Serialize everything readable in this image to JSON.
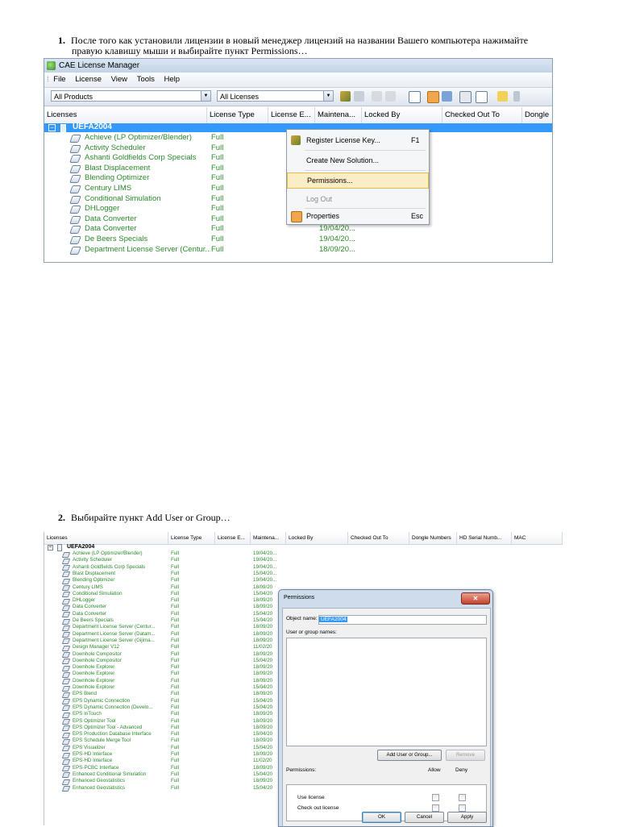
{
  "step1": {
    "number": "1.",
    "text_line1": "После того как установили лицензии в новый менеджер лицензий на названии Вашего компьютера нажимайте",
    "text_line2": "правую клавишу мыши и выбирайте пункт Permissions…"
  },
  "step2": {
    "number": "2.",
    "text": "Выбирайте пункт Add User or Group…"
  },
  "window1": {
    "title": "CAE License Manager",
    "app_icon": "cae-app-icon",
    "menu": [
      "File",
      "License",
      "View",
      "Tools",
      "Help"
    ],
    "products_filter": "All Products",
    "licenses_filter": "All Licenses",
    "columns": [
      "Licenses",
      "License Type",
      "License E...",
      "Maintena...",
      "Locked By",
      "Checked Out To",
      "Dongle"
    ],
    "root_node": "UEFA2004",
    "rows": [
      {
        "name": "Achieve (LP Optimizer/Blender)",
        "type": "Full",
        "date": ""
      },
      {
        "name": "Activity Scheduler",
        "type": "Full",
        "date": ""
      },
      {
        "name": "Ashanti Goldfields Corp Specials",
        "type": "Full",
        "date": ""
      },
      {
        "name": "Blast Displacement",
        "type": "Full",
        "date": ""
      },
      {
        "name": "Blending Optimizer",
        "type": "Full",
        "date": ""
      },
      {
        "name": "Century LIMS",
        "type": "Full",
        "date": ""
      },
      {
        "name": "Conditional Simulation",
        "type": "Full",
        "date": ""
      },
      {
        "name": "DHLogger",
        "type": "Full",
        "date": ""
      },
      {
        "name": "Data Converter",
        "type": "Full",
        "date": ""
      },
      {
        "name": "Data Converter",
        "type": "Full",
        "date": "19/04/20..."
      },
      {
        "name": "De Beers Specials",
        "type": "Full",
        "date": "19/04/20..."
      },
      {
        "name": "Department License Server (Centur...",
        "type": "Full",
        "date": "18/09/20..."
      }
    ],
    "context_menu": [
      {
        "label": "Register License Key...",
        "shortcut": "F1",
        "icon": "key-icon",
        "state": "normal"
      },
      {
        "label": "Create New Solution...",
        "shortcut": "",
        "icon": "",
        "state": "normal"
      },
      {
        "label": "Permissions...",
        "shortcut": "",
        "icon": "",
        "state": "highlighted"
      },
      {
        "label": "Log Out",
        "shortcut": "",
        "icon": "",
        "state": "disabled"
      },
      {
        "label": "Properties",
        "shortcut": "Esc",
        "icon": "properties-icon",
        "state": "normal"
      }
    ]
  },
  "window2": {
    "columns": [
      "Licenses",
      "License Type",
      "License E...",
      "Maintena...",
      "Locked By",
      "Checked Out To",
      "Dongle Numbers",
      "HD Serial Numb...",
      "MAC"
    ],
    "root_node": "UEFA2004",
    "rows": [
      {
        "name": "Achieve (LP Optimizer/Blender)",
        "type": "Full",
        "date": "19/04/20..."
      },
      {
        "name": "Activity Scheduler",
        "type": "Full",
        "date": "19/04/20..."
      },
      {
        "name": "Ashanti Goldfields Corp Specials",
        "type": "Full",
        "date": "19/04/20..."
      },
      {
        "name": "Blast Displacement",
        "type": "Full",
        "date": "15/04/20..."
      },
      {
        "name": "Blending Optimizer",
        "type": "Full",
        "date": "19/04/20..."
      },
      {
        "name": "Century LIMS",
        "type": "Full",
        "date": "18/09/20"
      },
      {
        "name": "Conditional Simulation",
        "type": "Full",
        "date": "15/04/20"
      },
      {
        "name": "DHLogger",
        "type": "Full",
        "date": "18/09/20"
      },
      {
        "name": "Data Converter",
        "type": "Full",
        "date": "18/09/20"
      },
      {
        "name": "Data Converter",
        "type": "Full",
        "date": "15/04/20"
      },
      {
        "name": "De Beers Specials",
        "type": "Full",
        "date": "15/04/20"
      },
      {
        "name": "Department License Server (Centur...",
        "type": "Full",
        "date": "18/09/20"
      },
      {
        "name": "Department License Server (Datam...",
        "type": "Full",
        "date": "18/09/20"
      },
      {
        "name": "Department License Server (Gijima...",
        "type": "Full",
        "date": "18/09/20"
      },
      {
        "name": "Design Manager V12",
        "type": "Full",
        "date": "11/02/20"
      },
      {
        "name": "Downhole Compositor",
        "type": "Full",
        "date": "18/09/20"
      },
      {
        "name": "Downhole Compositor",
        "type": "Full",
        "date": "15/04/20"
      },
      {
        "name": "Downhole Explorer",
        "type": "Full",
        "date": "18/09/20"
      },
      {
        "name": "Downhole Explorer",
        "type": "Full",
        "date": "18/09/20"
      },
      {
        "name": "Downhole Explorer",
        "type": "Full",
        "date": "18/09/20"
      },
      {
        "name": "Downhole Explorer",
        "type": "Full",
        "date": "15/04/20"
      },
      {
        "name": "EPS Blend",
        "type": "Full",
        "date": "18/09/20"
      },
      {
        "name": "EPS Dynamic Connection",
        "type": "Full",
        "date": "15/04/20"
      },
      {
        "name": "EPS Dynamic Connection (Develo...",
        "type": "Full",
        "date": "15/04/20"
      },
      {
        "name": "EPS InTouch",
        "type": "Full",
        "date": "18/09/20"
      },
      {
        "name": "EPS Optimizer Tool",
        "type": "Full",
        "date": "18/09/20"
      },
      {
        "name": "EPS Optimizer Tool - Advanced",
        "type": "Full",
        "date": "18/09/20"
      },
      {
        "name": "EPS Production Database Interface",
        "type": "Full",
        "date": "15/04/20"
      },
      {
        "name": "EPS Schedule Merge Tool",
        "type": "Full",
        "date": "18/09/20"
      },
      {
        "name": "EPS Visualizer",
        "type": "Full",
        "date": "15/04/20"
      },
      {
        "name": "EPS-HD Interface",
        "type": "Full",
        "date": "18/09/20"
      },
      {
        "name": "EPS-HD Interface",
        "type": "Full",
        "date": "11/02/20"
      },
      {
        "name": "EPS-PCBC Interface",
        "type": "Full",
        "date": "18/09/20"
      },
      {
        "name": "Enhanced Conditional Simulation",
        "type": "Full",
        "date": "15/04/20"
      },
      {
        "name": "Enhanced Geostatistics",
        "type": "Full",
        "date": "18/09/20"
      },
      {
        "name": "Enhanced Geostatistics",
        "type": "Full",
        "date": "15/04/20"
      }
    ]
  },
  "dialog": {
    "title": "Permissions",
    "close_glyph": "✕",
    "object_name_label": "Object name:",
    "object_name_value": "UEFA2004",
    "users_label": "User or group names:",
    "add_button": "Add User or Group...",
    "remove_button": "Remove",
    "permissions_label": "Permissions:",
    "allow_label": "Allow",
    "deny_label": "Deny",
    "permissions": [
      {
        "name": "Use license",
        "allow": false,
        "deny": false
      },
      {
        "name": "Check out license",
        "allow": false,
        "deny": false
      }
    ],
    "ok_button": "OK",
    "cancel_button": "Cancel",
    "apply_button": "Apply"
  }
}
